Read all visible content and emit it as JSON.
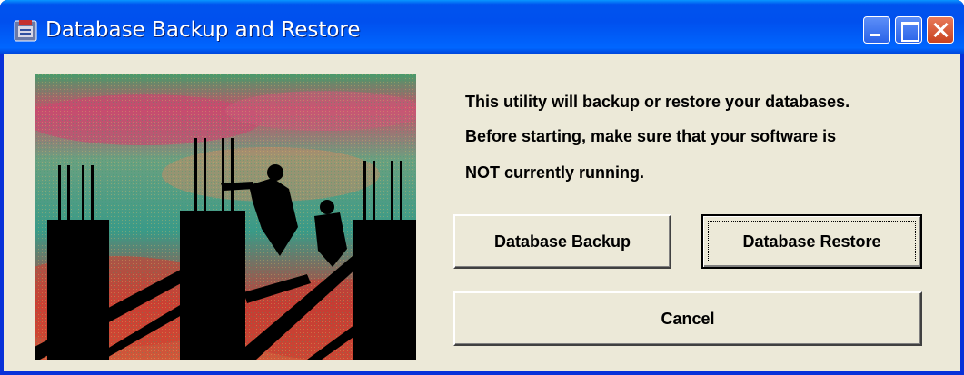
{
  "window": {
    "title": "Database Backup and Restore",
    "controls": [
      "minimize",
      "maximize",
      "close"
    ]
  },
  "message": {
    "line1": "This utility will backup or restore your databases.",
    "line2": "Before starting, make sure that your software is",
    "line3": "NOT currently running."
  },
  "buttons": {
    "backup": "Database Backup",
    "restore": "Database Restore",
    "cancel": "Cancel"
  },
  "colors": {
    "titlebar": "#0053ee",
    "client": "#ece9d8",
    "close_button": "#c8421f"
  },
  "icons": {
    "title": "database-app-icon",
    "minimize": "minimize-icon",
    "maximize": "maximize-icon",
    "close": "close-icon"
  }
}
